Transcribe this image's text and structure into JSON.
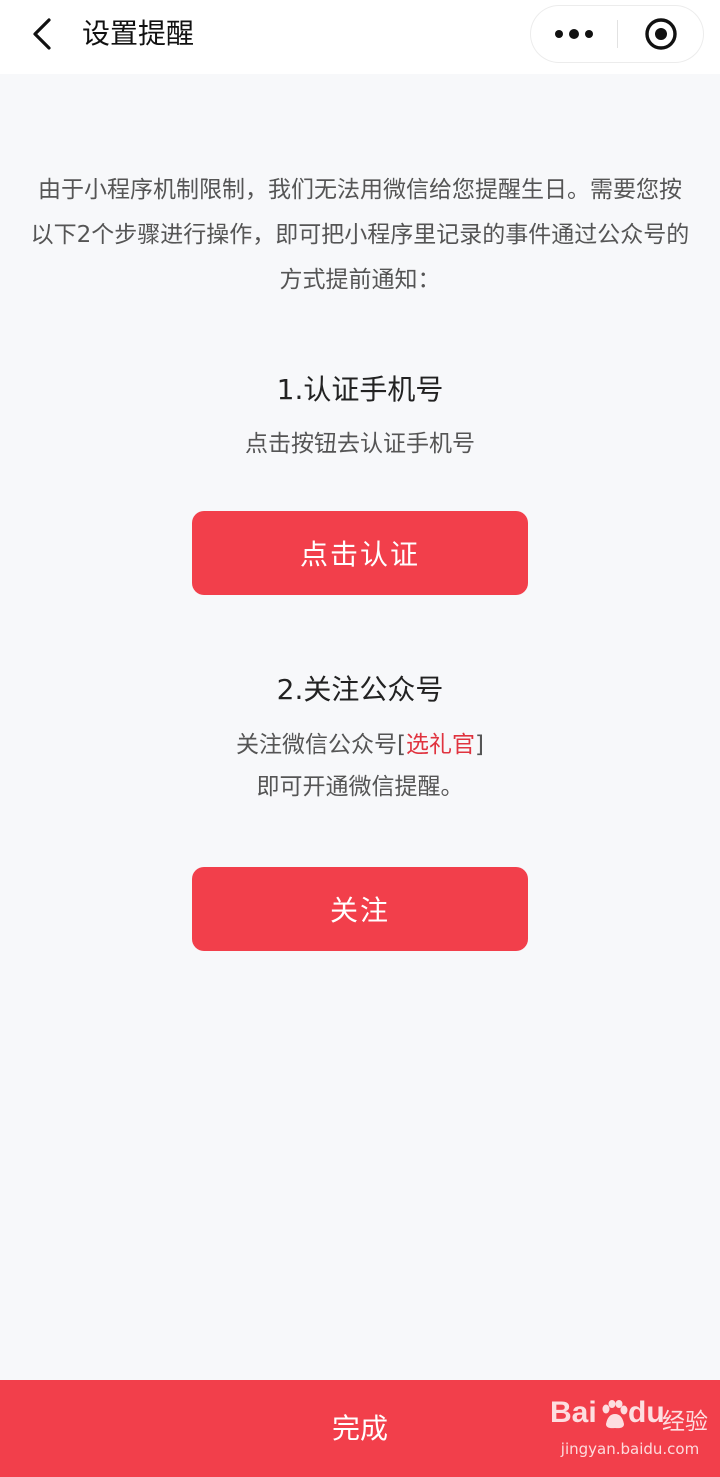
{
  "nav": {
    "title": "设置提醒"
  },
  "intro": {
    "text": "由于小程序机制限制，我们无法用微信给您提醒生日。需要您按以下2个步骤进行操作，即可把小程序里记录的事件通过公众号的方式提前通知："
  },
  "step1": {
    "title": "1.认证手机号",
    "desc": "点击按钮去认证手机号",
    "button": "点击认证"
  },
  "step2": {
    "title": "2.关注公众号",
    "desc_prefix": "关注微信公众号[",
    "desc_accent": "选礼官",
    "desc_suffix": "]",
    "desc_line2": "即可开通微信提醒。",
    "button": "关注"
  },
  "footer": {
    "button": "完成"
  },
  "watermark": {
    "brand": "Bai",
    "brand2": "du",
    "product": "经验",
    "url": "jingyan.baidu.com"
  },
  "colors": {
    "primary": "#f23f4b",
    "accent_text": "#e0333f",
    "background": "#f7f8fa"
  },
  "icons": {
    "back": "chevron-left-icon",
    "more": "more-dots-icon",
    "close": "target-circle-icon",
    "paw": "paw-icon"
  }
}
